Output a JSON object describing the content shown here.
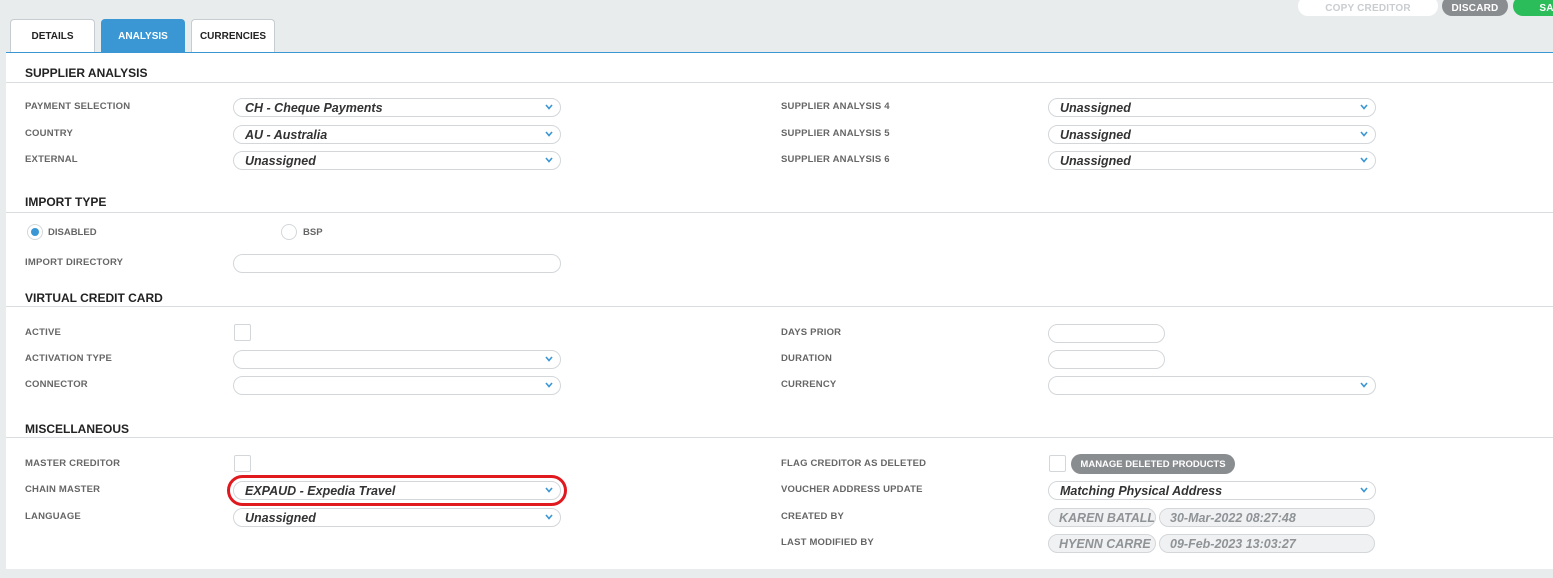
{
  "actions": {
    "copy_creditor": "COPY CREDITOR",
    "discard": "DISCARD",
    "save": "SAVE"
  },
  "tabs": [
    {
      "label": "DETAILS",
      "active": false
    },
    {
      "label": "ANALYSIS",
      "active": true
    },
    {
      "label": "CURRENCIES",
      "active": false
    }
  ],
  "supplier_analysis": {
    "title": "SUPPLIER ANALYSIS",
    "payment_selection": {
      "label": "PAYMENT SELECTION",
      "value": "CH - Cheque Payments"
    },
    "country": {
      "label": "COUNTRY",
      "value": "AU - Australia"
    },
    "external": {
      "label": "EXTERNAL",
      "value": "Unassigned"
    },
    "analysis4": {
      "label": "SUPPLIER ANALYSIS 4",
      "value": "Unassigned"
    },
    "analysis5": {
      "label": "SUPPLIER ANALYSIS 5",
      "value": "Unassigned"
    },
    "analysis6": {
      "label": "SUPPLIER ANALYSIS 6",
      "value": "Unassigned"
    }
  },
  "import_type": {
    "title": "IMPORT TYPE",
    "options": [
      {
        "label": "DISABLED",
        "selected": true
      },
      {
        "label": "BSP",
        "selected": false
      }
    ],
    "import_directory": {
      "label": "IMPORT DIRECTORY",
      "value": ""
    }
  },
  "virtual_credit_card": {
    "title": "VIRTUAL CREDIT CARD",
    "active": {
      "label": "ACTIVE",
      "checked": false
    },
    "activation_type": {
      "label": "ACTIVATION TYPE",
      "value": ""
    },
    "connector": {
      "label": "CONNECTOR",
      "value": ""
    },
    "days_prior": {
      "label": "DAYS PRIOR",
      "value": ""
    },
    "duration": {
      "label": "DURATION",
      "value": ""
    },
    "currency": {
      "label": "CURRENCY",
      "value": ""
    }
  },
  "miscellaneous": {
    "title": "MISCELLANEOUS",
    "master_creditor": {
      "label": "MASTER CREDITOR",
      "checked": false
    },
    "chain_master": {
      "label": "CHAIN MASTER",
      "value": "EXPAUD - Expedia Travel"
    },
    "language": {
      "label": "LANGUAGE",
      "value": "Unassigned"
    },
    "flag_deleted": {
      "label": "FLAG CREDITOR AS DELETED",
      "checked": false
    },
    "manage_deleted": "MANAGE DELETED PRODUCTS",
    "voucher_address": {
      "label": "VOUCHER ADDRESS UPDATE",
      "value": "Matching Physical Address"
    },
    "created_by": {
      "label": "CREATED BY",
      "user": "KAREN BATALL",
      "date": "30-Mar-2022 08:27:48"
    },
    "last_modified_by": {
      "label": "LAST MODIFIED BY",
      "user": "HYENN CARRE",
      "date": "09-Feb-2023 13:03:27"
    }
  },
  "colors": {
    "accent": "#3a97d4",
    "highlight": "#e0191f",
    "save": "#2bbd5a",
    "neutral_button": "#8a8d90"
  }
}
